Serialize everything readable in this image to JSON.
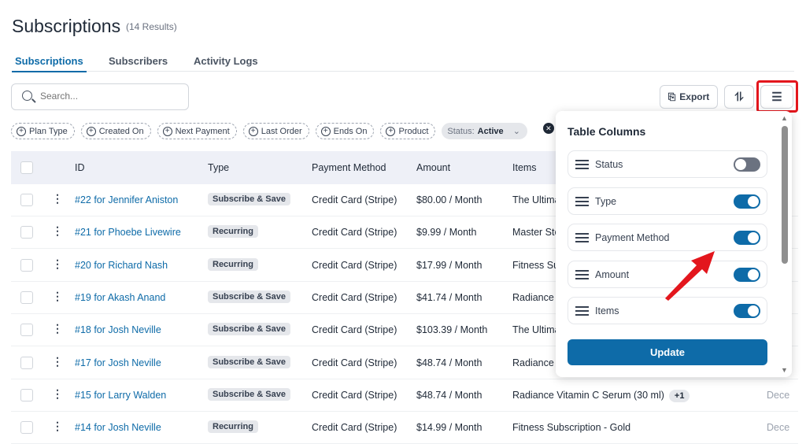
{
  "header": {
    "title": "Subscriptions",
    "count": "(14 Results)"
  },
  "tabs": [
    {
      "label": "Subscriptions",
      "active": true
    },
    {
      "label": "Subscribers"
    },
    {
      "label": "Activity Logs"
    }
  ],
  "search": {
    "placeholder": "Search...",
    "value": ""
  },
  "toolbar": {
    "export_label": "Export",
    "sort_icon": "sort-icon",
    "columns_icon": "sliders-icon"
  },
  "filters": [
    "Plan Type",
    "Created On",
    "Next Payment",
    "Last Order",
    "Ends On",
    "Product"
  ],
  "status_filter": {
    "label": "Status:",
    "value": "Active"
  },
  "table": {
    "headers": [
      "ID",
      "Type",
      "Payment Method",
      "Amount",
      "Items"
    ],
    "rows": [
      {
        "id": "#22 for Jennifer Aniston",
        "type": "Subscribe & Save",
        "pm": "Credit Card (Stripe)",
        "amount": "$80.00 / Month",
        "items": "The Ultima",
        "extra": "",
        "last": ""
      },
      {
        "id": "#21 for Phoebe Livewire",
        "type": "Recurring",
        "pm": "Credit Card (Stripe)",
        "amount": "$9.99 / Month",
        "items": "Master Sto",
        "extra": "",
        "last": ""
      },
      {
        "id": "#20 for Richard Nash",
        "type": "Recurring",
        "pm": "Credit Card (Stripe)",
        "amount": "$17.99 / Month",
        "items": "Fitness Sul",
        "extra": "",
        "last": ""
      },
      {
        "id": "#19 for Akash Anand",
        "type": "Subscribe & Save",
        "pm": "Credit Card (Stripe)",
        "amount": "$41.74 / Month",
        "items": "Radiance V",
        "extra": "",
        "last": ""
      },
      {
        "id": "#18 for Josh Neville",
        "type": "Subscribe & Save",
        "pm": "Credit Card (Stripe)",
        "amount": "$103.39 / Month",
        "items": "The Ultima",
        "extra": "",
        "last": ""
      },
      {
        "id": "#17 for Josh Neville",
        "type": "Subscribe & Save",
        "pm": "Credit Card (Stripe)",
        "amount": "$48.74 / Month",
        "items": "Radiance V",
        "extra": "",
        "last": ""
      },
      {
        "id": "#15 for Larry Walden",
        "type": "Subscribe & Save",
        "pm": "Credit Card (Stripe)",
        "amount": "$48.74 / Month",
        "items": "Radiance Vitamin C Serum (30 ml)",
        "extra": "+1",
        "last": "Dece"
      },
      {
        "id": "#14 for Josh Neville",
        "type": "Recurring",
        "pm": "Credit Card (Stripe)",
        "amount": "$14.99 / Month",
        "items": "Fitness Subscription - Gold",
        "extra": "",
        "last": "Dece"
      }
    ]
  },
  "columns_panel": {
    "title": "Table Columns",
    "items": [
      {
        "label": "Status",
        "enabled": false
      },
      {
        "label": "Type",
        "enabled": true
      },
      {
        "label": "Payment Method",
        "enabled": true
      },
      {
        "label": "Amount",
        "enabled": true
      },
      {
        "label": "Items",
        "enabled": true
      }
    ],
    "update_label": "Update"
  },
  "colors": {
    "accent": "#0e6ba8",
    "highlight": "#e3161d"
  }
}
